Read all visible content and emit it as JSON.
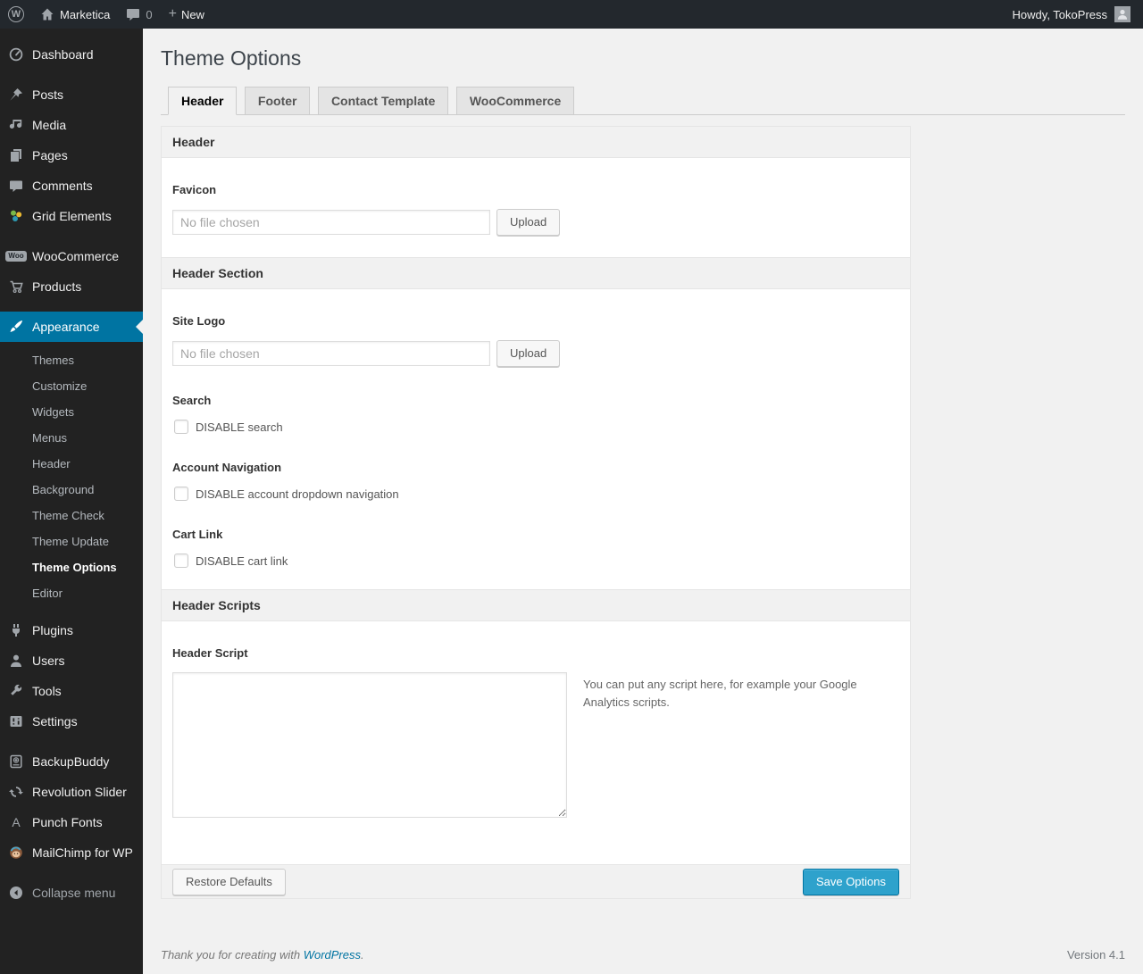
{
  "admin_bar": {
    "site_name": "Marketica",
    "comment_count": "0",
    "new_label": "New",
    "howdy_text": "Howdy, TokoPress"
  },
  "sidebar": {
    "items": [
      {
        "label": "Dashboard"
      },
      {
        "label": "Posts"
      },
      {
        "label": "Media"
      },
      {
        "label": "Pages"
      },
      {
        "label": "Comments"
      },
      {
        "label": "Grid Elements"
      },
      {
        "label": "WooCommerce"
      },
      {
        "label": "Products"
      },
      {
        "label": "Appearance"
      },
      {
        "label": "Plugins"
      },
      {
        "label": "Users"
      },
      {
        "label": "Tools"
      },
      {
        "label": "Settings"
      },
      {
        "label": "BackupBuddy"
      },
      {
        "label": "Revolution Slider"
      },
      {
        "label": "Punch Fonts"
      },
      {
        "label": "MailChimp for WP"
      }
    ],
    "appearance_submenu": [
      {
        "label": "Themes"
      },
      {
        "label": "Customize"
      },
      {
        "label": "Widgets"
      },
      {
        "label": "Menus"
      },
      {
        "label": "Header"
      },
      {
        "label": "Background"
      },
      {
        "label": "Theme Check"
      },
      {
        "label": "Theme Update"
      },
      {
        "label": "Theme Options"
      },
      {
        "label": "Editor"
      }
    ],
    "woo_badge": "Woo",
    "punch_fonts_glyph": "A",
    "collapse_label": "Collapse menu"
  },
  "page": {
    "title": "Theme Options",
    "tabs": [
      {
        "label": "Header",
        "active": true
      },
      {
        "label": "Footer",
        "active": false
      },
      {
        "label": "Contact Template",
        "active": false
      },
      {
        "label": "WooCommerce",
        "active": false
      }
    ],
    "panel": {
      "section_header_1": "Header",
      "favicon_label": "Favicon",
      "favicon_placeholder": "No file chosen",
      "upload_label": "Upload",
      "section_header_2": "Header Section",
      "site_logo_label": "Site Logo",
      "site_logo_placeholder": "No file chosen",
      "search_label": "Search",
      "search_checkbox_label": "DISABLE search",
      "account_nav_label": "Account Navigation",
      "account_nav_checkbox_label": "DISABLE account dropdown navigation",
      "cart_link_label": "Cart Link",
      "cart_link_checkbox_label": "DISABLE cart link",
      "section_header_3": "Header Scripts",
      "header_script_label": "Header Script",
      "header_script_value": "",
      "header_script_help": "You can put any script here, for example your Google Analytics scripts.",
      "restore_button": "Restore Defaults",
      "save_button": "Save Options"
    }
  },
  "page_footer": {
    "thanks_text": "Thank you for creating with",
    "wordpress_link": "WordPress",
    "suffix": ".",
    "version": "Version 4.1"
  },
  "colors": {
    "accent_blue": "#0074a2",
    "button_primary_blue": "#2ea2cc",
    "admin_bar_bg": "#23282d",
    "menu_bg": "#222222",
    "content_bg": "#f1f1f1"
  }
}
